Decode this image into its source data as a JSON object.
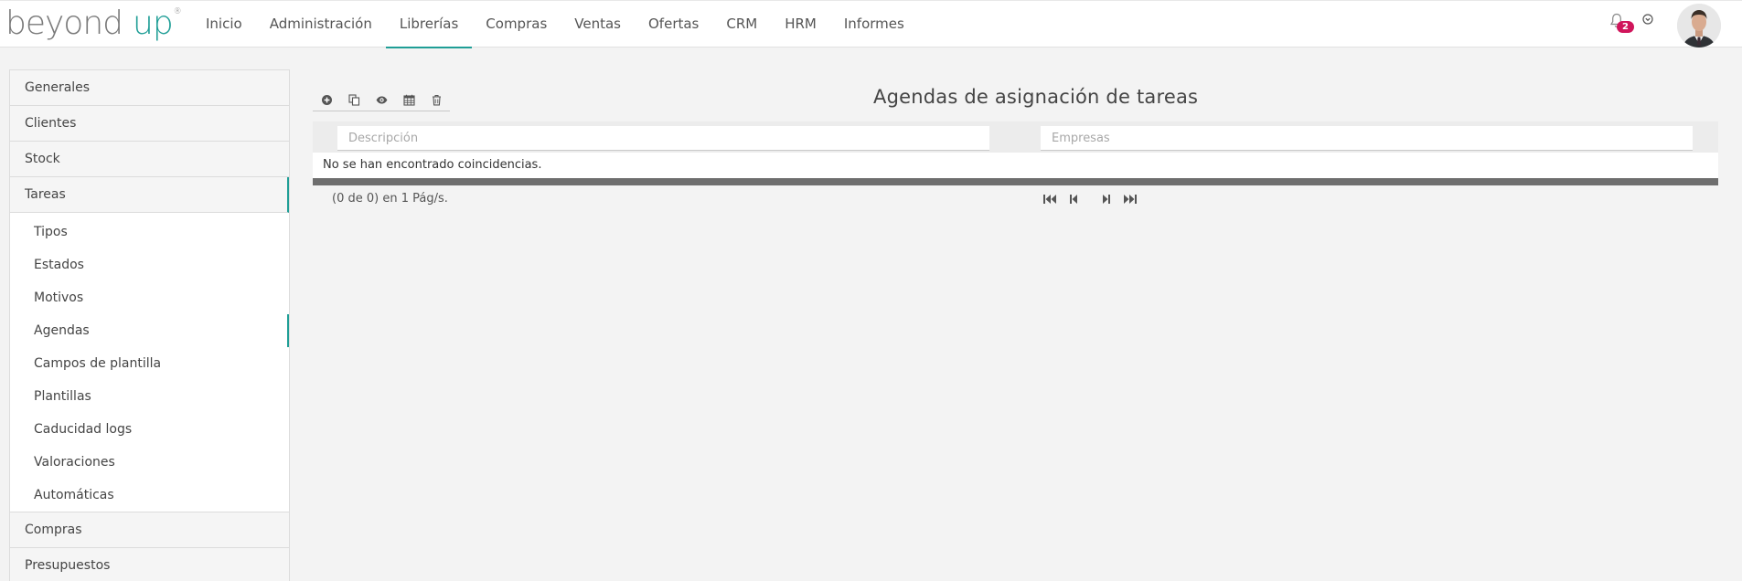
{
  "brand": {
    "word1": "beyond",
    "word2": "up",
    "reg": "®",
    "accent": "#1f9e96"
  },
  "nav": {
    "items": [
      {
        "label": "Inicio"
      },
      {
        "label": "Administración"
      },
      {
        "label": "Librerías",
        "active": true
      },
      {
        "label": "Compras"
      },
      {
        "label": "Ventas"
      },
      {
        "label": "Ofertas"
      },
      {
        "label": "CRM"
      },
      {
        "label": "HRM"
      },
      {
        "label": "Informes"
      }
    ]
  },
  "header_right": {
    "notifications_icon": "bell-icon",
    "notification_count": "2",
    "badge_color": "#d0155b",
    "options_icon": "circle-chevron-icon",
    "avatar": "user-avatar"
  },
  "sidebar": {
    "sections_top": [
      {
        "label": "Generales"
      },
      {
        "label": "Clientes"
      },
      {
        "label": "Stock"
      }
    ],
    "open_section": {
      "label": "Tareas"
    },
    "sub_items": [
      {
        "label": "Tipos"
      },
      {
        "label": "Estados"
      },
      {
        "label": "Motivos"
      },
      {
        "label": "Agendas",
        "active": true
      },
      {
        "label": "Campos de plantilla"
      },
      {
        "label": "Plantillas"
      },
      {
        "label": "Caducidad logs"
      },
      {
        "label": "Valoraciones"
      },
      {
        "label": "Automáticas"
      }
    ],
    "sections_bottom": [
      {
        "label": "Compras"
      },
      {
        "label": "Presupuestos"
      }
    ]
  },
  "toolbar": {
    "buttons": [
      {
        "icon": "plus-circle-icon"
      },
      {
        "icon": "copy-icon"
      },
      {
        "icon": "eye-icon"
      },
      {
        "icon": "calendar-icon"
      },
      {
        "icon": "trash-icon"
      }
    ]
  },
  "main": {
    "title": "Agendas de asignación de tareas",
    "filters": {
      "descripcion_placeholder": "Descripción",
      "empresas_placeholder": "Empresas"
    },
    "empty_message": "No se han encontrado coincidencias.",
    "pager": {
      "summary": "(0 de 0) en 1 Pág/s.",
      "buttons": [
        {
          "icon": "first-page-icon"
        },
        {
          "icon": "prev-page-icon"
        },
        {
          "icon": "next-page-icon"
        },
        {
          "icon": "last-page-icon"
        }
      ]
    }
  }
}
